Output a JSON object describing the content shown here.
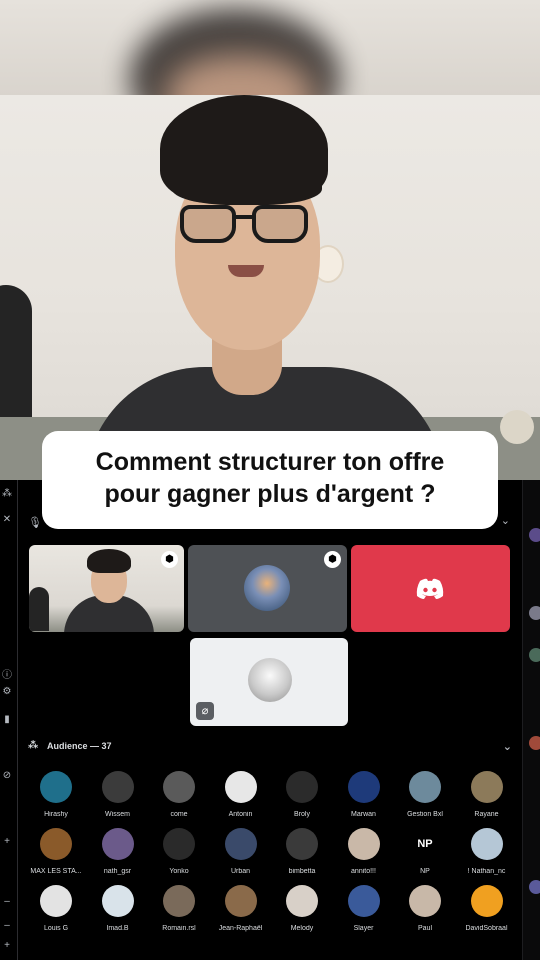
{
  "caption": {
    "line1": "Comment structurer ton offre",
    "line2": "pour gagner plus d'argent ?"
  },
  "audience": {
    "label": "Audience — 37",
    "members": [
      {
        "name": "Hirashy",
        "color": "#1f6f8b",
        "mark": ""
      },
      {
        "name": "Wissem",
        "color": "#3b3b3b",
        "mark": ""
      },
      {
        "name": "come",
        "color": "#5a5a5a",
        "mark": ""
      },
      {
        "name": "Antonin",
        "color": "#e7e7e7",
        "mark": ""
      },
      {
        "name": "Broly",
        "color": "#2b2b2b",
        "mark": ""
      },
      {
        "name": "Marwan",
        "color": "#1e3a7a",
        "mark": ""
      },
      {
        "name": "Gestion Bxl",
        "color": "#6d8a9c",
        "mark": ""
      },
      {
        "name": "Rayane",
        "color": "#8c7a5a",
        "mark": ""
      },
      {
        "name": "MAX LES STA...",
        "color": "#8a5a2a",
        "mark": ""
      },
      {
        "name": "nath_gsr",
        "color": "#6b5a8a",
        "mark": ""
      },
      {
        "name": "Yonko",
        "color": "#2a2a2a",
        "mark": ""
      },
      {
        "name": "Urban",
        "color": "#3a4a6a",
        "mark": ""
      },
      {
        "name": "bimbetta",
        "color": "#3a3a3a",
        "mark": ""
      },
      {
        "name": "annito!!!",
        "color": "#c9b8a8",
        "mark": ""
      },
      {
        "name": "NP",
        "color": "#000000",
        "mark": "NP"
      },
      {
        "name": "! Nathan_nc",
        "color": "#b5c7d6",
        "mark": ""
      },
      {
        "name": "Louis G",
        "color": "#e3e3e3",
        "mark": ""
      },
      {
        "name": "Imad.B",
        "color": "#d9e3ea",
        "mark": ""
      },
      {
        "name": "Romain.rsl",
        "color": "#7a6a5a",
        "mark": ""
      },
      {
        "name": "Jean-Raphaël",
        "color": "#8a6a4a",
        "mark": ""
      },
      {
        "name": "Melody",
        "color": "#d8d0c8",
        "mark": ""
      },
      {
        "name": "Slayer",
        "color": "#3a5a9a",
        "mark": ""
      },
      {
        "name": "Paul",
        "color": "#c8b8a8",
        "mark": ""
      },
      {
        "name": "DavidSobraal",
        "color": "#f0a020",
        "mark": ""
      }
    ]
  },
  "colors": {
    "background": "#000000",
    "discord_red": "#e0394b",
    "tile_gray": "#4e5155",
    "tile_white": "#eef0f2",
    "text_muted": "#dbdee1"
  }
}
